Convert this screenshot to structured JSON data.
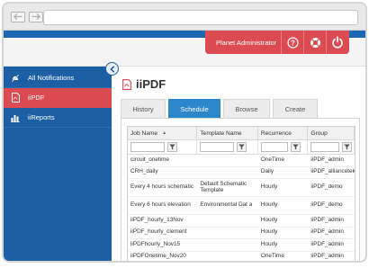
{
  "header": {
    "user_label": "Planet Administrator",
    "buttons": [
      {
        "name": "help-button",
        "icon": "help-icon"
      },
      {
        "name": "support-button",
        "icon": "lifebuoy-icon"
      },
      {
        "name": "logout-button",
        "icon": "power-icon"
      }
    ]
  },
  "sidebar": {
    "items": [
      {
        "label": "All Notifications",
        "icon": "bell-off-icon",
        "active": false
      },
      {
        "label": "iiPDF",
        "icon": "pdf-icon",
        "active": true
      },
      {
        "label": "iiReports",
        "icon": "bar-chart-icon",
        "active": false
      }
    ]
  },
  "main": {
    "title": "iiPDF",
    "tabs": [
      "History",
      "Schedule",
      "Browse",
      "Create"
    ],
    "active_tab": "Schedule"
  },
  "table": {
    "columns": [
      "Job Name",
      "Template Name",
      "Recurrence",
      "Group"
    ],
    "sort_indicator": "▲",
    "rows": [
      [
        "circuit_onetime",
        "",
        "OneTime",
        "iiPDF_admin"
      ],
      [
        "CRH_daily",
        "",
        "Daily",
        "iiPDF_alliancetek"
      ],
      [
        "Every 4 hours schematic",
        "Default Schematic Template",
        "Hourly",
        "iiPDF_demo"
      ],
      [
        "Every 6 hours elevation",
        "Environmental Dat a",
        "Hourly",
        "iiPDF_demo"
      ],
      [
        "iiPDF_hourly_13Nov",
        "",
        "Hourly",
        "iiPDF_admin"
      ],
      [
        "iiPDF_hourly_clement",
        "",
        "Hourly",
        "iiPDF_admin"
      ],
      [
        "iiPDFhourly_Nov15",
        "",
        "Hourly",
        "iiPDF_admin"
      ],
      [
        "iiPDFOnetime_Nov20",
        "",
        "OneTime",
        "iiPDF_admin"
      ]
    ]
  },
  "colors": {
    "brand_blue": "#1c5fa4",
    "accent_red": "#dc4a52",
    "tab_active": "#2e86cb"
  }
}
